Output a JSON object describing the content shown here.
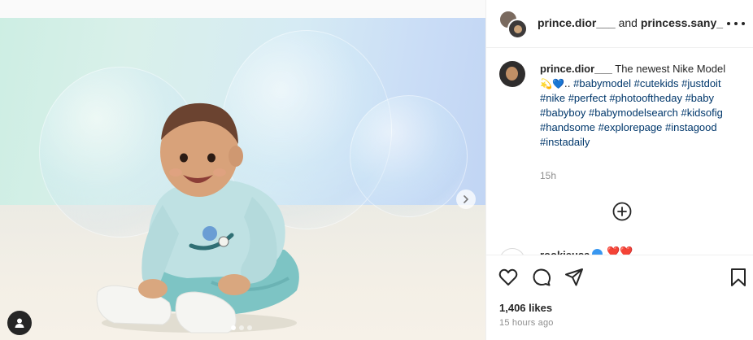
{
  "post": {
    "header": {
      "user1": "prince.dior___",
      "joiner": "and",
      "user2": "princess.sany_"
    },
    "caption": {
      "username": "prince.dior___",
      "text": "The newest Nike Model",
      "emojis": "💫💙..",
      "hashtags": [
        "#babymodel",
        "#cutekids",
        "#justdoit",
        "#nike",
        "#perfect",
        "#photooftheday",
        "#baby",
        "#babyboy",
        "#babymodelsearch",
        "#kidsofig",
        "#handsome",
        "#explorepage",
        "#instagood",
        "#instadaily"
      ],
      "time": "15h"
    },
    "comment_preview": {
      "username": "rookieusa",
      "hearts": "❤️❤️"
    },
    "likes": "1,406 likes",
    "posted_ago": "15 hours ago",
    "carousel": {
      "count": 3,
      "active_index": 0
    }
  },
  "icons": {
    "more": "more-dots-icon",
    "like": "heart-icon",
    "comment": "comment-icon",
    "share": "share-icon",
    "save": "bookmark-icon",
    "load_more": "plus-circle-icon",
    "next": "chevron-right-icon",
    "tag": "user-tag-icon"
  },
  "colors": {
    "hashtag": "#00376b",
    "muted": "#8e8e8e",
    "text": "#262626",
    "verified": "#3897f0"
  }
}
